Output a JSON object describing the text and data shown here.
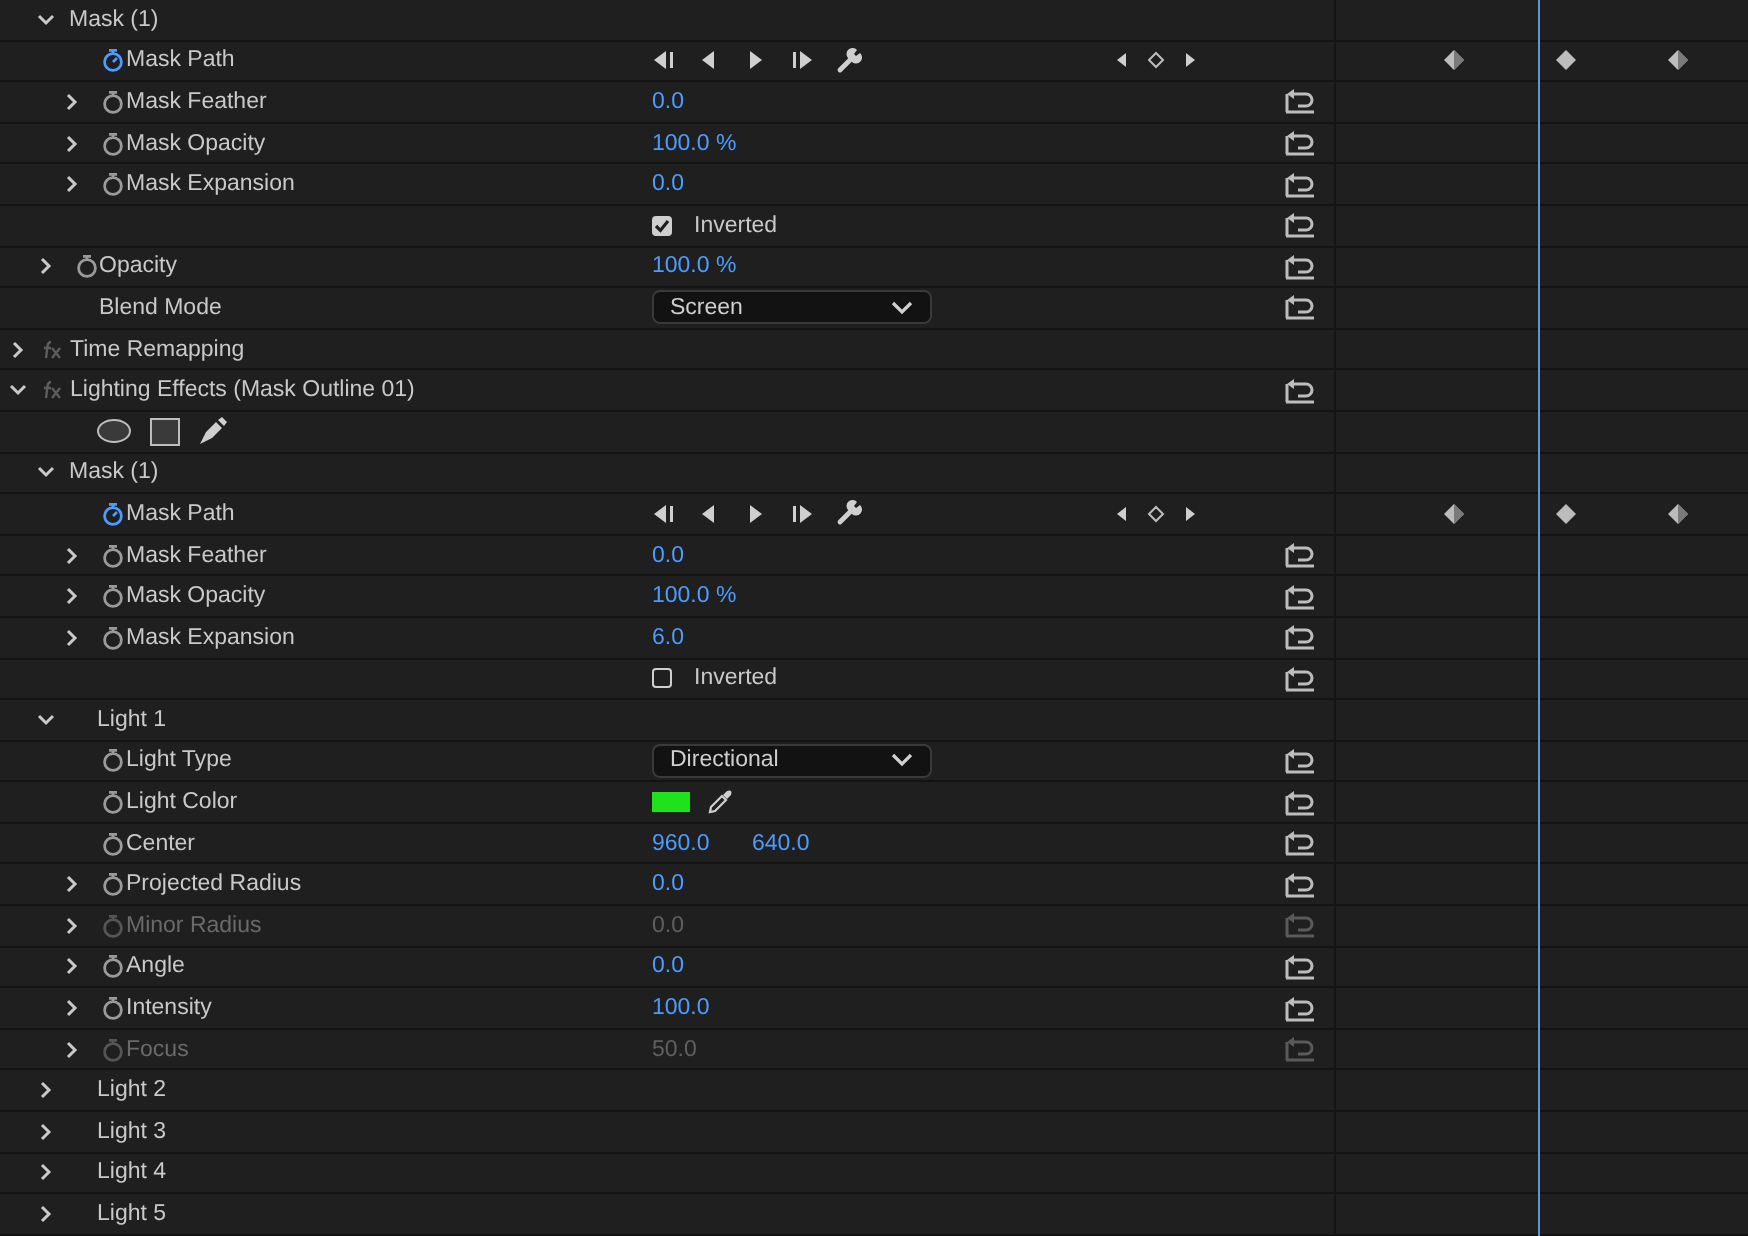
{
  "tree": [
    {
      "kind": "continued",
      "children": [
        {
          "kind": "mask",
          "label": "Mask (1)",
          "expanded": true,
          "reset": false,
          "children": [
            {
              "kind": "property",
              "label": "Mask Path",
              "stopwatch_on": true,
              "disabled": false,
              "reset": false,
              "control": {
                "kind": "keyframe-nav"
              },
              "keyframes": [
                {
                  "kind": "half"
                },
                {
                  "kind": "full"
                },
                {
                  "kind": "half"
                }
              ]
            },
            {
              "kind": "property",
              "label": "Mask Feather",
              "expanded": false,
              "stopwatch_on": false,
              "disabled": false,
              "reset": true,
              "control": {
                "kind": "number",
                "value": "0.0"
              }
            },
            {
              "kind": "property",
              "label": "Mask Opacity",
              "expanded": false,
              "stopwatch_on": false,
              "disabled": false,
              "reset": true,
              "control": {
                "kind": "number",
                "value": "100.0 %"
              }
            },
            {
              "kind": "property",
              "label": "Mask Expansion",
              "expanded": false,
              "stopwatch_on": false,
              "disabled": false,
              "reset": true,
              "control": {
                "kind": "number",
                "value": "0.0"
              }
            },
            {
              "kind": "checkbox",
              "label": "Inverted",
              "checked": true,
              "reset": true
            }
          ]
        },
        {
          "kind": "property",
          "label": "Opacity",
          "expanded": false,
          "stopwatch_on": false,
          "disabled": false,
          "reset": true,
          "control": {
            "kind": "number",
            "value": "100.0 %"
          }
        },
        {
          "kind": "property",
          "label": "Blend Mode",
          "disabled": false,
          "reset": true,
          "control": {
            "kind": "select",
            "value": "Screen"
          }
        }
      ]
    },
    {
      "kind": "effect",
      "label": "Time Remapping",
      "expanded": false,
      "reset": false
    },
    {
      "kind": "effect",
      "label": "Lighting Effects (Mask Outline 01)",
      "expanded": true,
      "reset": true,
      "children": [
        {
          "kind": "tools"
        },
        {
          "kind": "mask",
          "label": "Mask (1)",
          "expanded": true,
          "reset": false,
          "children": [
            {
              "kind": "property",
              "label": "Mask Path",
              "stopwatch_on": true,
              "disabled": false,
              "reset": false,
              "control": {
                "kind": "keyframe-nav"
              },
              "keyframes": [
                {
                  "kind": "half"
                },
                {
                  "kind": "full"
                },
                {
                  "kind": "half"
                }
              ]
            },
            {
              "kind": "property",
              "label": "Mask Feather",
              "expanded": false,
              "stopwatch_on": false,
              "disabled": false,
              "reset": true,
              "control": {
                "kind": "number",
                "value": "0.0"
              }
            },
            {
              "kind": "property",
              "label": "Mask Opacity",
              "expanded": false,
              "stopwatch_on": false,
              "disabled": false,
              "reset": true,
              "control": {
                "kind": "number",
                "value": "100.0 %"
              }
            },
            {
              "kind": "property",
              "label": "Mask Expansion",
              "expanded": false,
              "stopwatch_on": false,
              "disabled": false,
              "reset": true,
              "control": {
                "kind": "number",
                "value": "6.0"
              }
            },
            {
              "kind": "checkbox",
              "label": "Inverted",
              "checked": false,
              "reset": true
            }
          ]
        },
        {
          "kind": "group",
          "label": "Light 1",
          "expanded": true,
          "reset": false,
          "children": [
            {
              "kind": "property",
              "label": "Light Type",
              "stopwatch_on": false,
              "disabled": false,
              "reset": true,
              "control": {
                "kind": "select",
                "value": "Directional"
              }
            },
            {
              "kind": "property",
              "label": "Light Color",
              "stopwatch_on": false,
              "disabled": false,
              "reset": true,
              "control": {
                "kind": "color",
                "color": "#1ee31a"
              }
            },
            {
              "kind": "property",
              "label": "Center",
              "stopwatch_on": false,
              "disabled": false,
              "reset": true,
              "control": {
                "kind": "pair",
                "values": [
                  "960.0",
                  "640.0"
                ]
              }
            },
            {
              "kind": "property",
              "label": "Projected Radius",
              "expanded": false,
              "stopwatch_on": false,
              "disabled": false,
              "reset": true,
              "control": {
                "kind": "number",
                "value": "0.0"
              }
            },
            {
              "kind": "property",
              "label": "Minor Radius",
              "expanded": false,
              "stopwatch_on": false,
              "disabled": true,
              "reset": true,
              "control": {
                "kind": "number",
                "value": "0.0"
              }
            },
            {
              "kind": "property",
              "label": "Angle",
              "expanded": false,
              "stopwatch_on": false,
              "disabled": false,
              "reset": true,
              "control": {
                "kind": "number",
                "value": "0.0"
              }
            },
            {
              "kind": "property",
              "label": "Intensity",
              "expanded": false,
              "stopwatch_on": false,
              "disabled": false,
              "reset": true,
              "control": {
                "kind": "number",
                "value": "100.0"
              }
            },
            {
              "kind": "property",
              "label": "Focus",
              "expanded": false,
              "stopwatch_on": false,
              "disabled": true,
              "reset": true,
              "control": {
                "kind": "number",
                "value": "50.0"
              }
            }
          ]
        },
        {
          "kind": "group",
          "label": "Light 2",
          "expanded": false,
          "reset": false
        },
        {
          "kind": "group",
          "label": "Light 3",
          "expanded": false,
          "reset": false
        },
        {
          "kind": "group",
          "label": "Light 4",
          "expanded": false,
          "reset": false
        },
        {
          "kind": "group",
          "label": "Light 5",
          "expanded": false,
          "reset": false
        }
      ]
    }
  ]
}
